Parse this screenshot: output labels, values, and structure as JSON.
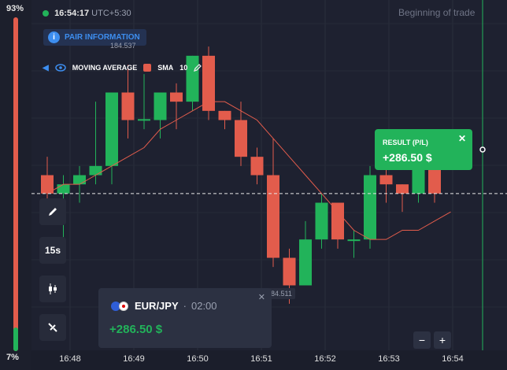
{
  "sentiment": {
    "top_pct": "93%",
    "bottom_pct": "7%",
    "up_fraction": 0.07
  },
  "header": {
    "time": "16:54:17",
    "timezone": "UTC+5:30",
    "beginning_label": "Beginning of trade"
  },
  "pair_info": {
    "label": "PAIR INFORMATION"
  },
  "indicator": {
    "name": "MOVING AVERAGE",
    "type": "SMA",
    "period": "10"
  },
  "tools": {
    "timeframe": "15s"
  },
  "price_tags": {
    "top": "184.537",
    "bottom": "84.511"
  },
  "result": {
    "title": "RESULT (P/L)",
    "value": "+286.50 $"
  },
  "trade": {
    "pair": "EUR/JPY",
    "sep": "·",
    "duration": "02:00",
    "profit": "+286.50 $"
  },
  "zoom": {
    "minus": "−",
    "plus": "+"
  },
  "time_axis": [
    "16:48",
    "16:49",
    "16:50",
    "16:51",
    "16:52",
    "16:53",
    "16:54"
  ],
  "colors": {
    "up": "#22b35a",
    "down": "#e25c4c",
    "accent": "#3d8ef0",
    "bg": "#1e2130"
  },
  "candles": [
    {
      "t": "16:47:45",
      "o": 184.528,
      "h": 184.53,
      "l": 184.524,
      "c": 184.526
    },
    {
      "t": "16:48:00",
      "o": 184.526,
      "h": 184.528,
      "l": 184.52,
      "c": 184.527
    },
    {
      "t": "16:48:15",
      "o": 184.527,
      "h": 184.529,
      "l": 184.525,
      "c": 184.528
    },
    {
      "t": "16:48:30",
      "o": 184.528,
      "h": 184.536,
      "l": 184.527,
      "c": 184.529
    },
    {
      "t": "16:48:45",
      "o": 184.529,
      "h": 184.537,
      "l": 184.527,
      "c": 184.537
    },
    {
      "t": "16:49:00",
      "o": 184.537,
      "h": 184.54,
      "l": 184.532,
      "c": 184.534
    },
    {
      "t": "16:49:15",
      "o": 184.534,
      "h": 184.539,
      "l": 184.533,
      "c": 184.5341
    },
    {
      "t": "16:49:30",
      "o": 184.534,
      "h": 184.537,
      "l": 184.532,
      "c": 184.537
    },
    {
      "t": "16:49:45",
      "o": 184.537,
      "h": 184.538,
      "l": 184.533,
      "c": 184.536
    },
    {
      "t": "16:50:00",
      "o": 184.536,
      "h": 184.541,
      "l": 184.535,
      "c": 184.541
    },
    {
      "t": "16:50:15",
      "o": 184.541,
      "h": 184.542,
      "l": 184.534,
      "c": 184.535
    },
    {
      "t": "16:50:30",
      "o": 184.535,
      "h": 184.535,
      "l": 184.533,
      "c": 184.534
    },
    {
      "t": "16:50:45",
      "o": 184.534,
      "h": 184.536,
      "l": 184.529,
      "c": 184.53
    },
    {
      "t": "16:51:00",
      "o": 184.53,
      "h": 184.531,
      "l": 184.527,
      "c": 184.528
    },
    {
      "t": "16:51:15",
      "o": 184.528,
      "h": 184.532,
      "l": 184.518,
      "c": 184.519
    },
    {
      "t": "16:51:30",
      "o": 184.519,
      "h": 184.52,
      "l": 184.514,
      "c": 184.516
    },
    {
      "t": "16:51:45",
      "o": 184.516,
      "h": 184.523,
      "l": 184.516,
      "c": 184.521
    },
    {
      "t": "16:52:00",
      "o": 184.521,
      "h": 184.526,
      "l": 184.52,
      "c": 184.525
    },
    {
      "t": "16:52:15",
      "o": 184.525,
      "h": 184.525,
      "l": 184.52,
      "c": 184.521
    },
    {
      "t": "16:52:30",
      "o": 184.521,
      "h": 184.522,
      "l": 184.519,
      "c": 184.521
    },
    {
      "t": "16:52:45",
      "o": 184.521,
      "h": 184.529,
      "l": 184.52,
      "c": 184.528
    },
    {
      "t": "16:53:00",
      "o": 184.528,
      "h": 184.53,
      "l": 184.525,
      "c": 184.527
    },
    {
      "t": "16:53:15",
      "o": 184.527,
      "h": 184.527,
      "l": 184.524,
      "c": 184.526
    },
    {
      "t": "16:53:30",
      "o": 184.526,
      "h": 184.53,
      "l": 184.525,
      "c": 184.529
    },
    {
      "t": "16:53:45",
      "o": 184.529,
      "h": 184.53,
      "l": 184.525,
      "c": 184.526
    }
  ],
  "sma": [
    184.526,
    184.527,
    184.527,
    184.528,
    184.529,
    184.53,
    184.531,
    184.533,
    184.534,
    184.535,
    184.536,
    184.536,
    184.535,
    184.534,
    184.532,
    184.53,
    184.528,
    184.526,
    184.524,
    184.522,
    184.521,
    184.521,
    184.522,
    184.522,
    184.523,
    184.524
  ],
  "current_price": 184.526
}
